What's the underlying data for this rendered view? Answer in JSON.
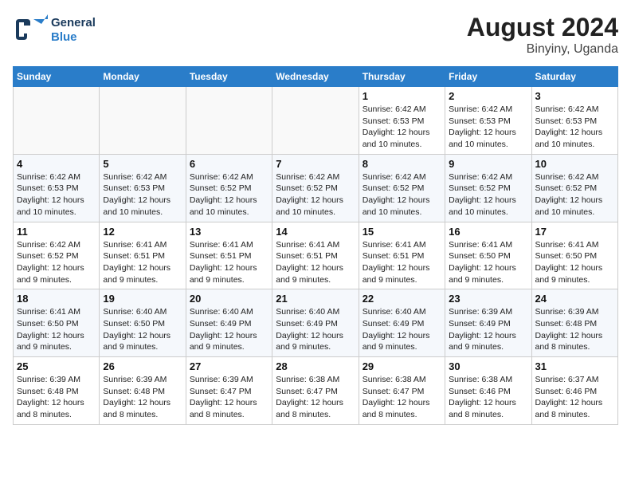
{
  "logo": {
    "line1": "General",
    "line2": "Blue"
  },
  "title": "August 2024",
  "location": "Binyiny, Uganda",
  "weekdays": [
    "Sunday",
    "Monday",
    "Tuesday",
    "Wednesday",
    "Thursday",
    "Friday",
    "Saturday"
  ],
  "weeks": [
    [
      {
        "day": "",
        "info": ""
      },
      {
        "day": "",
        "info": ""
      },
      {
        "day": "",
        "info": ""
      },
      {
        "day": "",
        "info": ""
      },
      {
        "day": "1",
        "sunrise": "6:42 AM",
        "sunset": "6:53 PM",
        "daylight": "12 hours and 10 minutes."
      },
      {
        "day": "2",
        "sunrise": "6:42 AM",
        "sunset": "6:53 PM",
        "daylight": "12 hours and 10 minutes."
      },
      {
        "day": "3",
        "sunrise": "6:42 AM",
        "sunset": "6:53 PM",
        "daylight": "12 hours and 10 minutes."
      }
    ],
    [
      {
        "day": "4",
        "sunrise": "6:42 AM",
        "sunset": "6:53 PM",
        "daylight": "12 hours and 10 minutes."
      },
      {
        "day": "5",
        "sunrise": "6:42 AM",
        "sunset": "6:53 PM",
        "daylight": "12 hours and 10 minutes."
      },
      {
        "day": "6",
        "sunrise": "6:42 AM",
        "sunset": "6:52 PM",
        "daylight": "12 hours and 10 minutes."
      },
      {
        "day": "7",
        "sunrise": "6:42 AM",
        "sunset": "6:52 PM",
        "daylight": "12 hours and 10 minutes."
      },
      {
        "day": "8",
        "sunrise": "6:42 AM",
        "sunset": "6:52 PM",
        "daylight": "12 hours and 10 minutes."
      },
      {
        "day": "9",
        "sunrise": "6:42 AM",
        "sunset": "6:52 PM",
        "daylight": "12 hours and 10 minutes."
      },
      {
        "day": "10",
        "sunrise": "6:42 AM",
        "sunset": "6:52 PM",
        "daylight": "12 hours and 10 minutes."
      }
    ],
    [
      {
        "day": "11",
        "sunrise": "6:42 AM",
        "sunset": "6:52 PM",
        "daylight": "12 hours and 9 minutes."
      },
      {
        "day": "12",
        "sunrise": "6:41 AM",
        "sunset": "6:51 PM",
        "daylight": "12 hours and 9 minutes."
      },
      {
        "day": "13",
        "sunrise": "6:41 AM",
        "sunset": "6:51 PM",
        "daylight": "12 hours and 9 minutes."
      },
      {
        "day": "14",
        "sunrise": "6:41 AM",
        "sunset": "6:51 PM",
        "daylight": "12 hours and 9 minutes."
      },
      {
        "day": "15",
        "sunrise": "6:41 AM",
        "sunset": "6:51 PM",
        "daylight": "12 hours and 9 minutes."
      },
      {
        "day": "16",
        "sunrise": "6:41 AM",
        "sunset": "6:50 PM",
        "daylight": "12 hours and 9 minutes."
      },
      {
        "day": "17",
        "sunrise": "6:41 AM",
        "sunset": "6:50 PM",
        "daylight": "12 hours and 9 minutes."
      }
    ],
    [
      {
        "day": "18",
        "sunrise": "6:41 AM",
        "sunset": "6:50 PM",
        "daylight": "12 hours and 9 minutes."
      },
      {
        "day": "19",
        "sunrise": "6:40 AM",
        "sunset": "6:50 PM",
        "daylight": "12 hours and 9 minutes."
      },
      {
        "day": "20",
        "sunrise": "6:40 AM",
        "sunset": "6:49 PM",
        "daylight": "12 hours and 9 minutes."
      },
      {
        "day": "21",
        "sunrise": "6:40 AM",
        "sunset": "6:49 PM",
        "daylight": "12 hours and 9 minutes."
      },
      {
        "day": "22",
        "sunrise": "6:40 AM",
        "sunset": "6:49 PM",
        "daylight": "12 hours and 9 minutes."
      },
      {
        "day": "23",
        "sunrise": "6:39 AM",
        "sunset": "6:49 PM",
        "daylight": "12 hours and 9 minutes."
      },
      {
        "day": "24",
        "sunrise": "6:39 AM",
        "sunset": "6:48 PM",
        "daylight": "12 hours and 8 minutes."
      }
    ],
    [
      {
        "day": "25",
        "sunrise": "6:39 AM",
        "sunset": "6:48 PM",
        "daylight": "12 hours and 8 minutes."
      },
      {
        "day": "26",
        "sunrise": "6:39 AM",
        "sunset": "6:48 PM",
        "daylight": "12 hours and 8 minutes."
      },
      {
        "day": "27",
        "sunrise": "6:39 AM",
        "sunset": "6:47 PM",
        "daylight": "12 hours and 8 minutes."
      },
      {
        "day": "28",
        "sunrise": "6:38 AM",
        "sunset": "6:47 PM",
        "daylight": "12 hours and 8 minutes."
      },
      {
        "day": "29",
        "sunrise": "6:38 AM",
        "sunset": "6:47 PM",
        "daylight": "12 hours and 8 minutes."
      },
      {
        "day": "30",
        "sunrise": "6:38 AM",
        "sunset": "6:46 PM",
        "daylight": "12 hours and 8 minutes."
      },
      {
        "day": "31",
        "sunrise": "6:37 AM",
        "sunset": "6:46 PM",
        "daylight": "12 hours and 8 minutes."
      }
    ]
  ]
}
